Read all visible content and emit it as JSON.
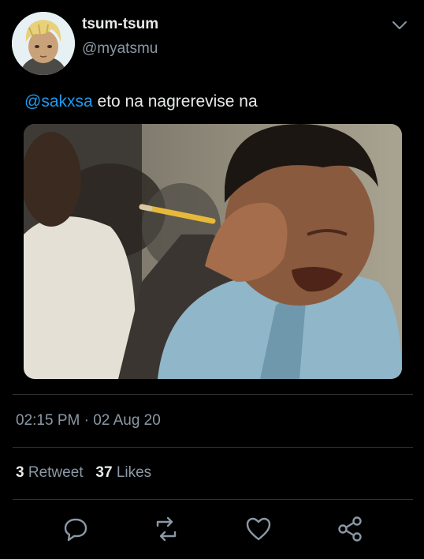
{
  "author": {
    "display_name": "tsum-tsum",
    "handle": "@myatsmu",
    "avatar_icon": "avatar-illustration"
  },
  "tweet": {
    "mention": "@sakxsa",
    "text": " eto na nagrerevise na",
    "media_description_icon": "photo"
  },
  "meta": {
    "timestamp": "02:15 PM · 02 Aug 20"
  },
  "stats": {
    "retweets_count": "3",
    "retweets_label": "Retweet",
    "likes_count": "37",
    "likes_label": "Likes"
  },
  "actions": {
    "reply_icon": "reply-icon",
    "retweet_icon": "retweet-icon",
    "like_icon": "heart-icon",
    "share_icon": "share-icon"
  },
  "colors": {
    "background": "#000000",
    "link": "#1d9bf0",
    "secondary_text": "#8b98a5",
    "primary_text": "#e7e9ea",
    "divider": "#2f3336"
  }
}
